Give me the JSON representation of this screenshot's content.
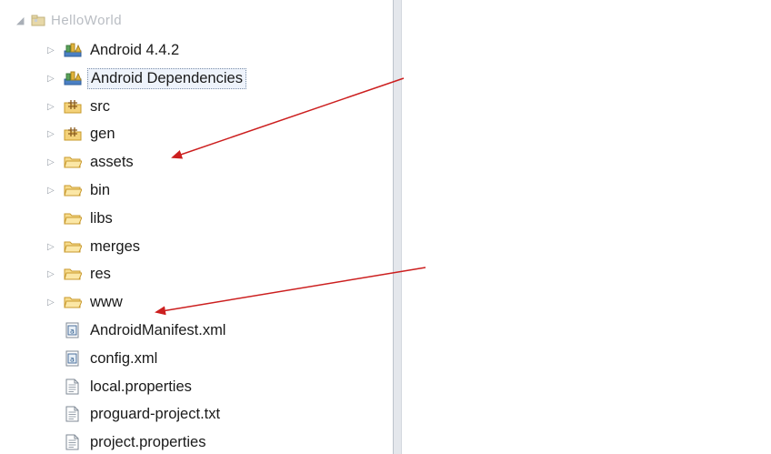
{
  "explorer": {
    "root": {
      "label": "HelloWorld",
      "expanded": true,
      "icon": "project-icon"
    },
    "items": [
      {
        "label": "Android 4.4.2",
        "icon": "library-icon",
        "expandable": true,
        "selected": false
      },
      {
        "label": "Android Dependencies",
        "icon": "library-icon",
        "expandable": true,
        "selected": true
      },
      {
        "label": "src",
        "icon": "source-folder-icon",
        "expandable": true,
        "selected": false
      },
      {
        "label": "gen",
        "icon": "source-folder-icon",
        "expandable": true,
        "selected": false
      },
      {
        "label": "assets",
        "icon": "folder-icon",
        "expandable": true,
        "selected": false
      },
      {
        "label": "bin",
        "icon": "folder-icon",
        "expandable": true,
        "selected": false
      },
      {
        "label": "libs",
        "icon": "folder-icon",
        "expandable": false,
        "selected": false
      },
      {
        "label": "merges",
        "icon": "folder-icon",
        "expandable": true,
        "selected": false
      },
      {
        "label": "res",
        "icon": "folder-icon",
        "expandable": true,
        "selected": false
      },
      {
        "label": "www",
        "icon": "folder-icon",
        "expandable": true,
        "selected": false
      },
      {
        "label": "AndroidManifest.xml",
        "icon": "xml-file-icon",
        "expandable": false,
        "selected": false
      },
      {
        "label": "config.xml",
        "icon": "xml-file-icon",
        "expandable": false,
        "selected": false
      },
      {
        "label": "local.properties",
        "icon": "text-file-icon",
        "expandable": false,
        "selected": false
      },
      {
        "label": "proguard-project.txt",
        "icon": "text-file-icon",
        "expandable": false,
        "selected": false
      },
      {
        "label": "project.properties",
        "icon": "text-file-icon",
        "expandable": false,
        "selected": false
      }
    ]
  },
  "annotations": [
    {
      "name": "annotation-arrow-assets",
      "color": "#cc1f1f"
    },
    {
      "name": "annotation-arrow-www",
      "color": "#cc1f1f"
    }
  ],
  "colors": {
    "folder": "#f2c94c",
    "library": "#3a6fb8",
    "arrow": "#cc1f1f",
    "divider": "#e4e7ec"
  }
}
